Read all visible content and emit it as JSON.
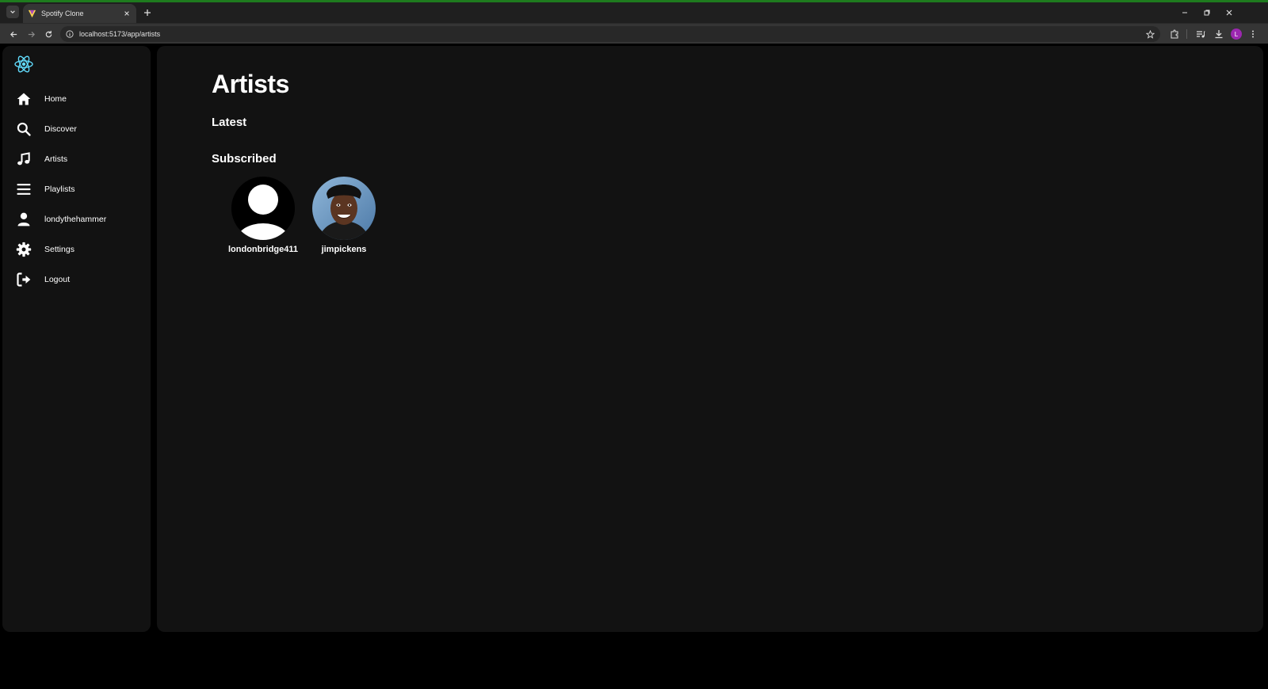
{
  "browser": {
    "tab_title": "Spotify Clone",
    "url": "localhost:5173/app/artists",
    "profile_initial": "L"
  },
  "sidebar": {
    "items": [
      {
        "label": "Home",
        "icon": "home-icon"
      },
      {
        "label": "Discover",
        "icon": "search-icon"
      },
      {
        "label": "Artists",
        "icon": "music-note-icon"
      },
      {
        "label": "Playlists",
        "icon": "list-icon"
      },
      {
        "label": "londythehammer",
        "icon": "user-icon"
      },
      {
        "label": "Settings",
        "icon": "gear-icon"
      },
      {
        "label": "Logout",
        "icon": "logout-icon"
      }
    ]
  },
  "main": {
    "title": "Artists",
    "sections": {
      "latest": "Latest",
      "subscribed": "Subscribed"
    },
    "subscribed_artists": [
      {
        "name": "londonbridge411",
        "avatar": "default-user-avatar"
      },
      {
        "name": "jimpickens",
        "avatar": "photo-avatar"
      }
    ]
  },
  "colors": {
    "accent": "#61dafb",
    "panel": "#121212",
    "background": "#000000"
  }
}
